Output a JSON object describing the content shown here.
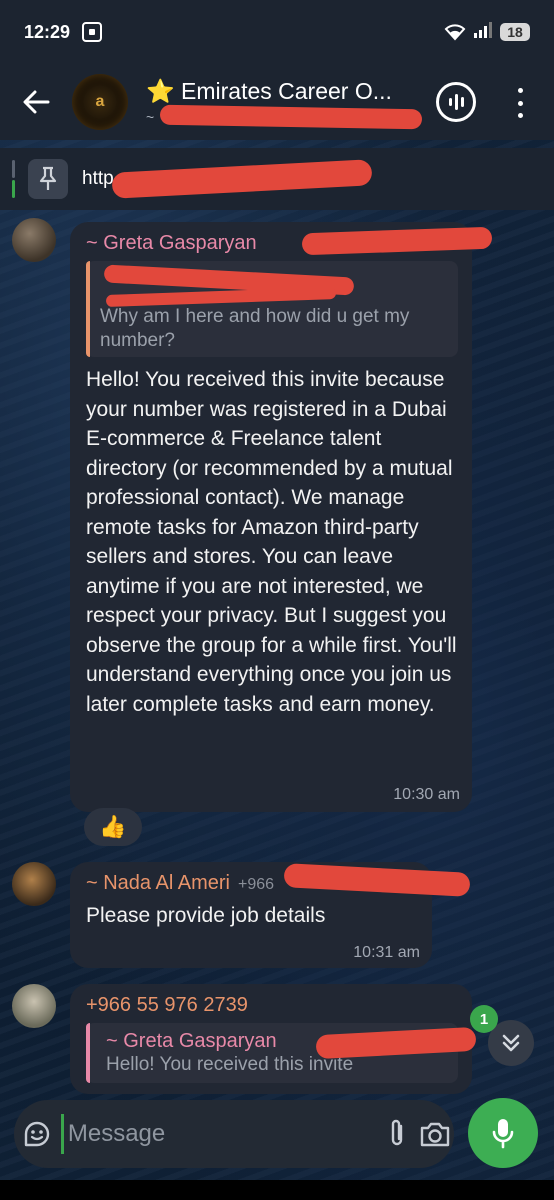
{
  "status_bar": {
    "time": "12:29",
    "battery": "18"
  },
  "header": {
    "title": "⭐ Emirates Career O...",
    "subtitle_prefix": "~"
  },
  "pinned": {
    "text": "http"
  },
  "messages": [
    {
      "sender": "~ Greta Gasparyan",
      "sender_color": "#e889a8",
      "reply_quote": "Why am I here and how did u get my number?",
      "text": "Hello! You received this invite because your number was registered in a Dubai E-commerce & Freelance talent directory (or recommended by a mutual professional contact). We manage remote tasks for Amazon third-party sellers and stores. You can leave anytime if you are not interested, we respect your privacy. But I suggest you observe the group for a while first. You'll understand everything once you join us later complete tasks and earn money.",
      "time": "10:30 am",
      "reaction": "👍"
    },
    {
      "sender": "~ Nada Al Ameri",
      "sender_color": "#e8946b",
      "phone_suffix": "+966",
      "text": "Please provide job details",
      "time": "10:31 am"
    },
    {
      "sender": "+966 55 976 2739",
      "sender_color": "#e8946b",
      "reply_sender": "~ Greta Gasparyan",
      "reply_sender_color": "#e889a8",
      "reply_quote": "Hello! You received this invite"
    }
  ],
  "scroll": {
    "unread_count": "1"
  },
  "composer": {
    "placeholder": "Message"
  },
  "colors": {
    "accent_green": "#3dae53",
    "redaction": "#e2483c",
    "bubble": "#212733"
  }
}
